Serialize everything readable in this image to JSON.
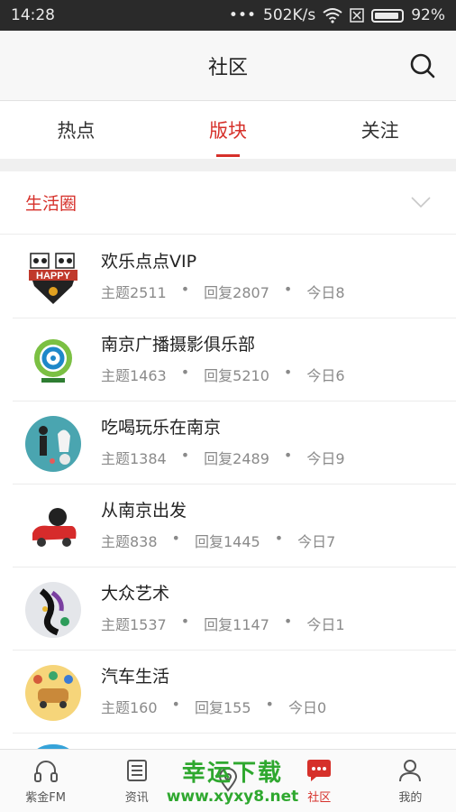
{
  "status_bar": {
    "time": "14:28",
    "signal_dots": "•••",
    "speed": "502K/s",
    "battery": "92%"
  },
  "header": {
    "title": "社区"
  },
  "tabs": [
    {
      "label": "热点",
      "active": false
    },
    {
      "label": "版块",
      "active": true
    },
    {
      "label": "关注",
      "active": false
    }
  ],
  "section": {
    "label": "生活圈"
  },
  "items": [
    {
      "name": "欢乐点点VIP",
      "topics": "主题2511",
      "replies": "回复2807",
      "today": "今日8"
    },
    {
      "name": "南京广播摄影俱乐部",
      "topics": "主题1463",
      "replies": "回复5210",
      "today": "今日6"
    },
    {
      "name": "吃喝玩乐在南京",
      "topics": "主题1384",
      "replies": "回复2489",
      "today": "今日9"
    },
    {
      "name": "从南京出发",
      "topics": "主题838",
      "replies": "回复1445",
      "today": "今日7"
    },
    {
      "name": "大众艺术",
      "topics": "主题1537",
      "replies": "回复1147",
      "today": "今日1"
    },
    {
      "name": "汽车生活",
      "topics": "主题160",
      "replies": "回复155",
      "today": "今日0"
    }
  ],
  "avatar_text": {
    "happy": "HAPPY"
  },
  "nav": [
    {
      "label": "紫金FM",
      "icon": "headphones-icon"
    },
    {
      "label": "资讯",
      "icon": "news-icon"
    },
    {
      "label": "",
      "icon": "location-icon"
    },
    {
      "label": "社区",
      "icon": "chat-icon",
      "active": true
    },
    {
      "label": "我的",
      "icon": "user-icon"
    }
  ],
  "watermark": {
    "line1": "幸运下载",
    "line2": "www.xyxy8.net"
  },
  "colors": {
    "accent": "#d6302a",
    "watermark": "#2fa82f"
  }
}
